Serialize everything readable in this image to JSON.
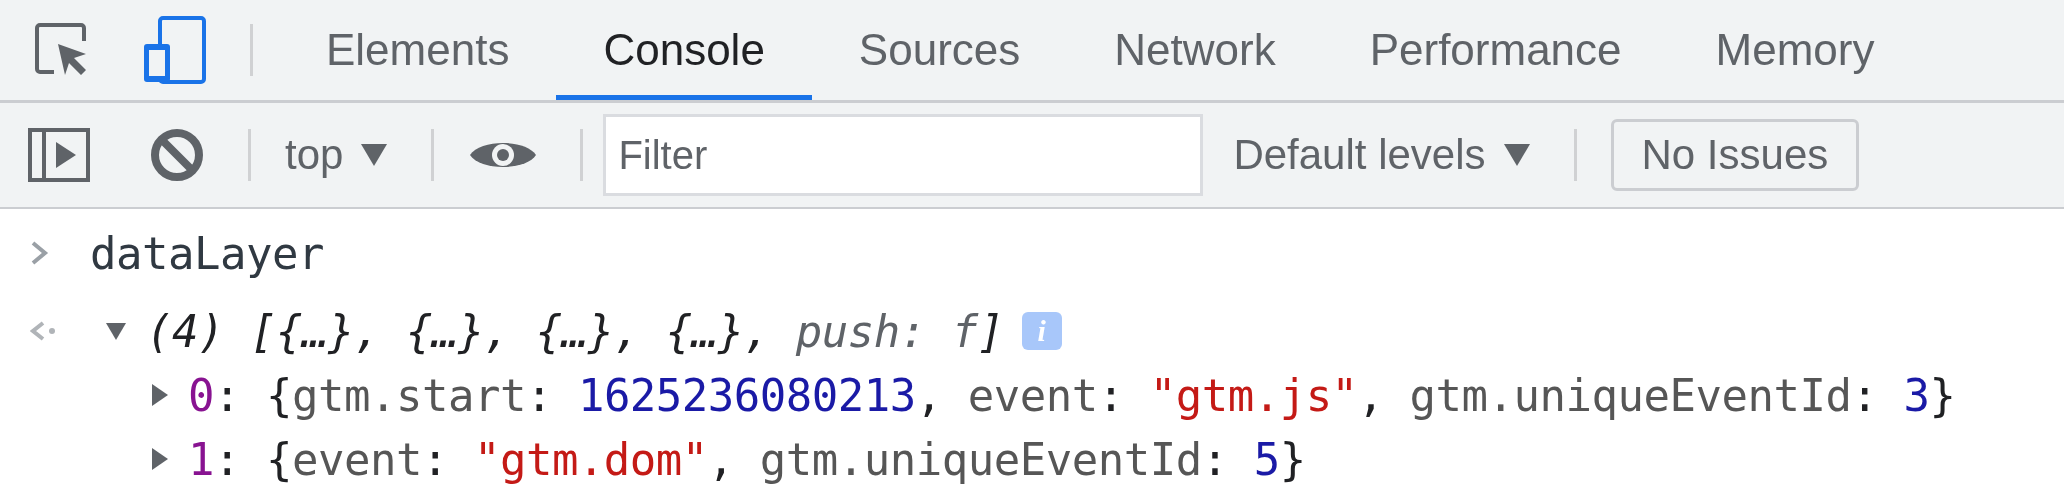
{
  "top_icons": {
    "device_mode_on": true
  },
  "tabs": [
    {
      "label": "Elements",
      "selected": false
    },
    {
      "label": "Console",
      "selected": true
    },
    {
      "label": "Sources",
      "selected": false
    },
    {
      "label": "Network",
      "selected": false
    },
    {
      "label": "Performance",
      "selected": false
    },
    {
      "label": "Memory",
      "selected": false
    }
  ],
  "toolbar": {
    "context": "top",
    "filter": {
      "placeholder": "Filter"
    },
    "levels": "Default levels",
    "issues_button": "No Issues"
  },
  "console": [
    {
      "kind": "input",
      "text": "dataLayer"
    },
    {
      "kind": "output",
      "expanded": true,
      "tokens": [
        {
          "kind": "punct",
          "text": "(4) [{…}, {…}, {…}, {…}, "
        },
        {
          "kind": "dim",
          "text": "push: f"
        },
        {
          "kind": "punct",
          "text": "]"
        }
      ],
      "badge": "i",
      "children": [
        {
          "expanded": false,
          "tokens": [
            {
              "kind": "index",
              "text": "0"
            },
            {
              "kind": "punct",
              "text": ": {"
            },
            {
              "kind": "key",
              "text": "gtm.start"
            },
            {
              "kind": "punct",
              "text": ": "
            },
            {
              "kind": "number",
              "text": "1625236080213"
            },
            {
              "kind": "punct",
              "text": ", "
            },
            {
              "kind": "key",
              "text": "event"
            },
            {
              "kind": "punct",
              "text": ": "
            },
            {
              "kind": "string",
              "text": "\"gtm.js\""
            },
            {
              "kind": "punct",
              "text": ", "
            },
            {
              "kind": "key",
              "text": "gtm.uniqueEventId"
            },
            {
              "kind": "punct",
              "text": ": "
            },
            {
              "kind": "number",
              "text": "3"
            },
            {
              "kind": "punct",
              "text": "}"
            }
          ]
        },
        {
          "expanded": false,
          "tokens": [
            {
              "kind": "index",
              "text": "1"
            },
            {
              "kind": "punct",
              "text": ": {"
            },
            {
              "kind": "key",
              "text": "event"
            },
            {
              "kind": "punct",
              "text": ": "
            },
            {
              "kind": "string",
              "text": "\"gtm.dom\""
            },
            {
              "kind": "punct",
              "text": ", "
            },
            {
              "kind": "key",
              "text": "gtm.uniqueEventId"
            },
            {
              "kind": "punct",
              "text": ": "
            },
            {
              "kind": "number",
              "text": "5"
            },
            {
              "kind": "punct",
              "text": "}"
            }
          ]
        }
      ]
    }
  ]
}
